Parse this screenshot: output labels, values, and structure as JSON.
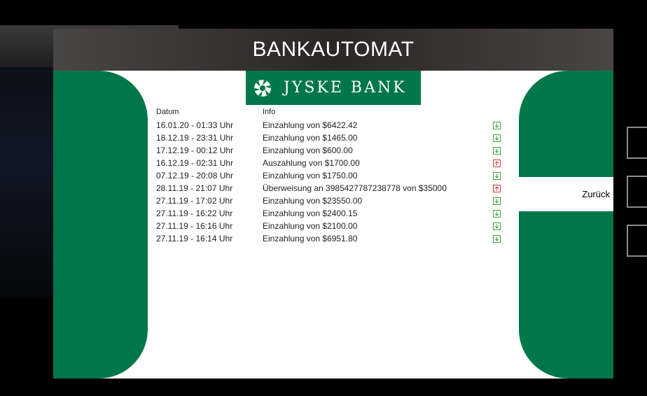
{
  "window": {
    "title": "BANKAUTOMAT"
  },
  "bank": {
    "name": "JYSKE BANK",
    "logo_icon": "jyske-bank-emblem-icon",
    "brand_color": "#00774a"
  },
  "table": {
    "headers": {
      "date": "Datum",
      "info": "Info"
    },
    "rows": [
      {
        "date": "16.01.20 - 01:33 Uhr",
        "info": "Einzahlung von $6422.42",
        "direction": "in"
      },
      {
        "date": "18.12.19 - 23:31 Uhr",
        "info": "Einzahlung von $1465.00",
        "direction": "in"
      },
      {
        "date": "17.12.19 - 00:12 Uhr",
        "info": "Einzahlung von $600.00",
        "direction": "in"
      },
      {
        "date": "16.12.19 - 02:31 Uhr",
        "info": "Auszahlung von $1700.00",
        "direction": "out"
      },
      {
        "date": "07.12.19 - 20:08 Uhr",
        "info": "Einzahlung von $1750.00",
        "direction": "in"
      },
      {
        "date": "28.11.19 - 21:07 Uhr",
        "info": "Überweisung an 3985427787238778 von $35000",
        "direction": "out"
      },
      {
        "date": "27.11.19 - 17:02 Uhr",
        "info": "Einzahlung von $23550.00",
        "direction": "in"
      },
      {
        "date": "27.11.19 - 16:22 Uhr",
        "info": "Einzahlung von $2400.15",
        "direction": "in"
      },
      {
        "date": "27.11.19 - 16:16 Uhr",
        "info": "Einzahlung von $2100.00",
        "direction": "in"
      },
      {
        "date": "27.11.19 - 16:14 Uhr",
        "info": "Einzahlung von $6951.80",
        "direction": "in"
      }
    ]
  },
  "actions": {
    "back_label": "Zurück"
  },
  "colors": {
    "deposit": "#39a539",
    "withdrawal": "#d23a3a"
  }
}
